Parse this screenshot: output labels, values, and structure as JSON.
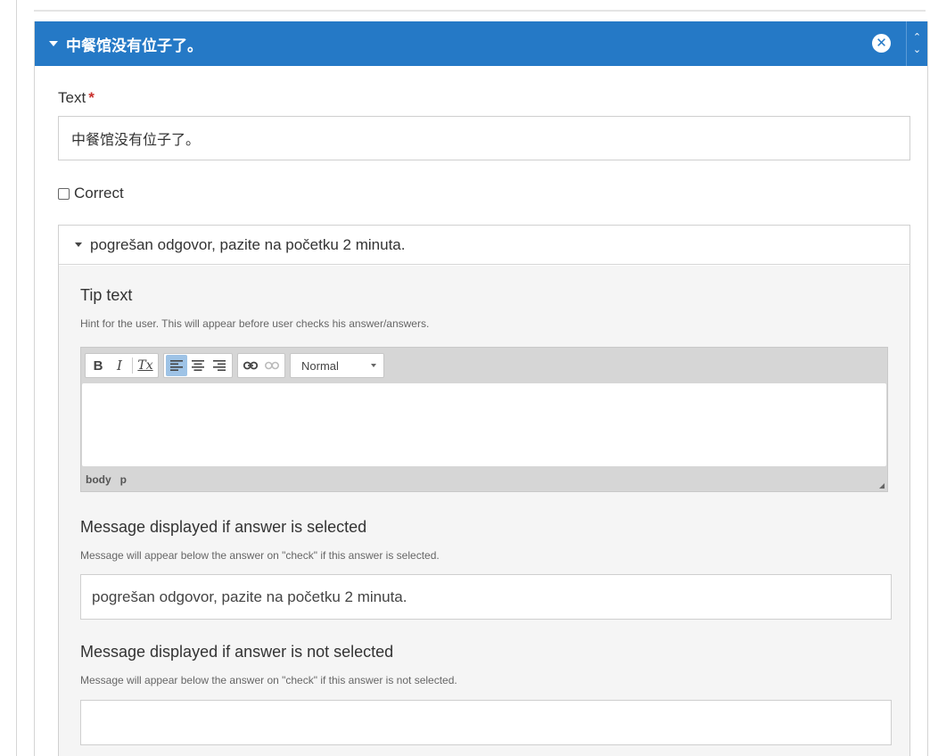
{
  "answer": {
    "header_title": "中餐馆没有位子了。",
    "close_icon": "close-circle-icon",
    "order_up_icon": "chevron-up-icon",
    "order_down_icon": "chevron-down-icon"
  },
  "text_field": {
    "label": "Text",
    "required_mark": "*",
    "value": "中餐馆没有位子了。"
  },
  "correct_checkbox": {
    "label": "Correct",
    "checked": false
  },
  "feedback_group": {
    "header": "pogrešan odgovor, pazite na početku 2 minuta.",
    "tip": {
      "title": "Tip text",
      "description": "Hint for the user. This will appear before user checks his answer/answers.",
      "toolbar": {
        "bold": "B",
        "italic": "I",
        "remove_format": "Tx",
        "format_value": "Normal"
      },
      "path": [
        "body",
        "p"
      ]
    },
    "selected_message": {
      "title": "Message displayed if answer is selected",
      "description": "Message will appear below the answer on \"check\" if this answer is selected.",
      "value": "pogrešan odgovor, pazite na početku 2 minuta."
    },
    "not_selected_message": {
      "title": "Message displayed if answer is not selected",
      "description": "Message will appear below the answer on \"check\" if this answer is not selected.",
      "value": ""
    }
  },
  "colors": {
    "header_blue": "#2579c6",
    "required_red": "#c9302c",
    "active_button": "#9ec3e6"
  }
}
